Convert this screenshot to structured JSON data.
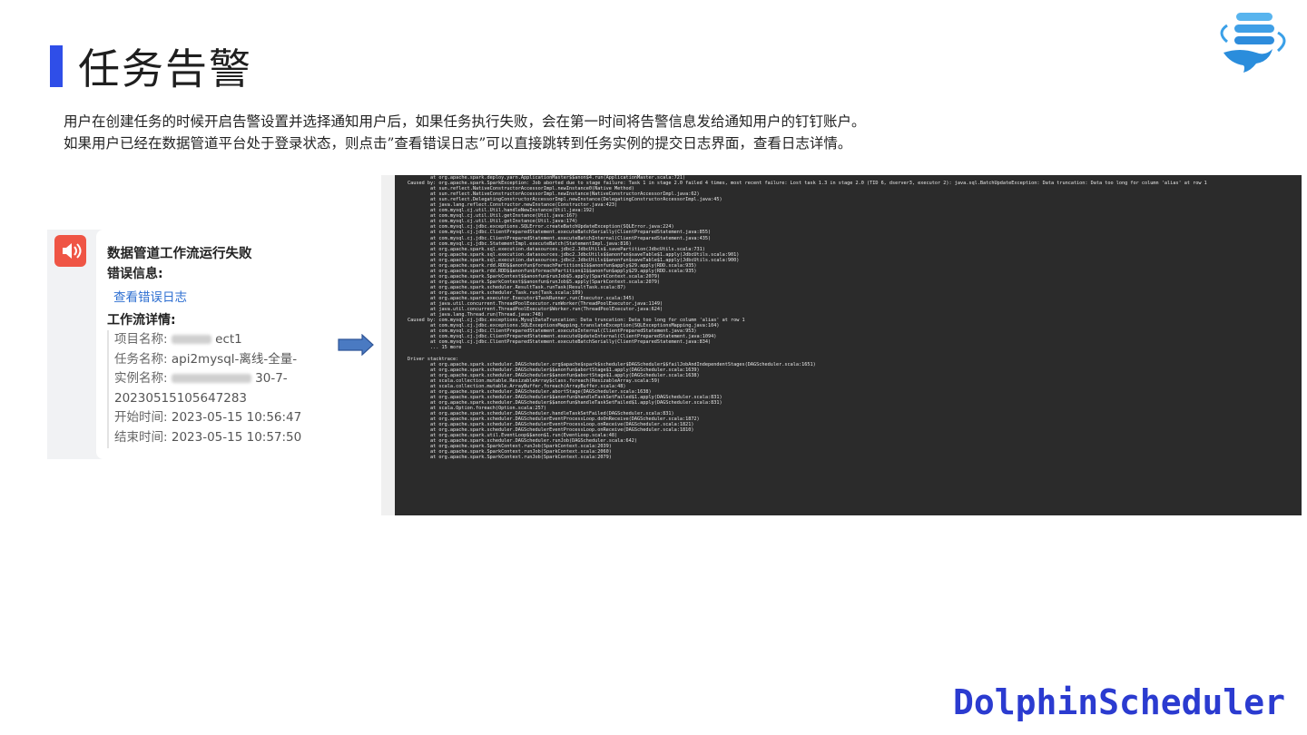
{
  "page": {
    "title": "任务告警",
    "description_line1": "用户在创建任务的时候开启告警设置并选择通知用户后，如果任务执行失败，会在第一时间将告警信息发给通知用户的钉钉账户。",
    "description_line2": "如果用户已经在数据管道平台处于登录状态，则点击”查看错误日志”可以直接跳转到任务实例的提交日志界面，查看日志详情。",
    "brand": "DolphinScheduler",
    "accent_color": "#2f4ee8"
  },
  "alert_card": {
    "icon": "speaker-alert-icon",
    "title": "数据管道工作流运行失败",
    "error_label": "错误信息:",
    "error_link": "查看错误日志",
    "detail_label": "工作流详情:",
    "project_label": "项目名称:",
    "project_value": "ect1",
    "task_label": "任务名称:",
    "task_value": "api2mysql-离线-全量-",
    "instance_label": "实例名称:",
    "instance_value_suffix": "30-7-",
    "instance_value_line2": "20230515105647283",
    "start_label": "开始时间:",
    "start_value": "2023-05-15 10:56:47",
    "end_label": "结束时间:",
    "end_value": "2023-05-15 10:57:50"
  },
  "log": {
    "lines": [
      "        at org.apache.spark.deploy.yarn.ApplicationMaster$$anon$4.run(ApplicationMaster.scala:721)",
      "Caused by: org.apache.spark.SparkException: Job aborted due to stage failure: Task 1 in stage 2.0 failed 4 times, most recent failure: Lost task 1.3 in stage 2.0 (TID 6, dserver3, executor 2): java.sql.BatchUpdateException: Data truncation: Data too long for column 'alias' at row 1",
      "        at sun.reflect.NativeConstructorAccessorImpl.newInstance0(Native Method)",
      "        at sun.reflect.NativeConstructorAccessorImpl.newInstance(NativeConstructorAccessorImpl.java:62)",
      "        at sun.reflect.DelegatingConstructorAccessorImpl.newInstance(DelegatingConstructorAccessorImpl.java:45)",
      "        at java.lang.reflect.Constructor.newInstance(Constructor.java:423)",
      "        at com.mysql.cj.util.Util.handleNewInstance(Util.java:192)",
      "        at com.mysql.cj.util.Util.getInstance(Util.java:167)",
      "        at com.mysql.cj.util.Util.getInstance(Util.java:174)",
      "        at com.mysql.cj.jdbc.exceptions.SQLError.createBatchUpdateException(SQLError.java:224)",
      "        at com.mysql.cj.jdbc.ClientPreparedStatement.executeBatchSerially(ClientPreparedStatement.java:855)",
      "        at com.mysql.cj.jdbc.ClientPreparedStatement.executeBatchInternal(ClientPreparedStatement.java:435)",
      "        at com.mysql.cj.jdbc.StatementImpl.executeBatch(StatementImpl.java:816)",
      "        at org.apache.spark.sql.execution.datasources.jdbc2.JdbcUtils$.savePartition(JdbcUtils.scala:731)",
      "        at org.apache.spark.sql.execution.datasources.jdbc2.JdbcUtils$$anonfun$saveTable$1.apply(JdbcUtils.scala:901)",
      "        at org.apache.spark.sql.execution.datasources.jdbc2.JdbcUtils$$anonfun$saveTable$1.apply(JdbcUtils.scala:900)",
      "        at org.apache.spark.rdd.RDD$$anonfun$foreachPartition$1$$anonfun$apply$29.apply(RDD.scala:935)",
      "        at org.apache.spark.rdd.RDD$$anonfun$foreachPartition$1$$anonfun$apply$29.apply(RDD.scala:935)",
      "        at org.apache.spark.SparkContext$$anonfun$runJob$5.apply(SparkContext.scala:2079)",
      "        at org.apache.spark.SparkContext$$anonfun$runJob$5.apply(SparkContext.scala:2079)",
      "        at org.apache.spark.scheduler.ResultTask.runTask(ResultTask.scala:87)",
      "        at org.apache.spark.scheduler.Task.run(Task.scala:109)",
      "        at org.apache.spark.executor.Executor$TaskRunner.run(Executor.scala:345)",
      "        at java.util.concurrent.ThreadPoolExecutor.runWorker(ThreadPoolExecutor.java:1149)",
      "        at java.util.concurrent.ThreadPoolExecutor$Worker.run(ThreadPoolExecutor.java:624)",
      "        at java.lang.Thread.run(Thread.java:748)",
      "Caused by: com.mysql.cj.jdbc.exceptions.MysqlDataTruncation: Data truncation: Data too long for column 'alias' at row 1",
      "        at com.mysql.cj.jdbc.exceptions.SQLExceptionsMapping.translateException(SQLExceptionsMapping.java:104)",
      "        at com.mysql.cj.jdbc.ClientPreparedStatement.executeInternal(ClientPreparedStatement.java:953)",
      "        at com.mysql.cj.jdbc.ClientPreparedStatement.executeUpdateInternal(ClientPreparedStatement.java:1094)",
      "        at com.mysql.cj.jdbc.ClientPreparedStatement.executeBatchSerially(ClientPreparedStatement.java:834)",
      "        ... 15 more",
      "",
      "Driver stacktrace:",
      "        at org.apache.spark.scheduler.DAGScheduler.org$apache$spark$scheduler$DAGScheduler$$failJobAndIndependentStages(DAGScheduler.scala:1651)",
      "        at org.apache.spark.scheduler.DAGScheduler$$anonfun$abortStage$1.apply(DAGScheduler.scala:1639)",
      "        at org.apache.spark.scheduler.DAGScheduler$$anonfun$abortStage$1.apply(DAGScheduler.scala:1638)",
      "        at scala.collection.mutable.ResizableArray$class.foreach(ResizableArray.scala:59)",
      "        at scala.collection.mutable.ArrayBuffer.foreach(ArrayBuffer.scala:48)",
      "        at org.apache.spark.scheduler.DAGScheduler.abortStage(DAGScheduler.scala:1638)",
      "        at org.apache.spark.scheduler.DAGScheduler$$anonfun$handleTaskSetFailed$1.apply(DAGScheduler.scala:831)",
      "        at org.apache.spark.scheduler.DAGScheduler$$anonfun$handleTaskSetFailed$1.apply(DAGScheduler.scala:831)",
      "        at scala.Option.foreach(Option.scala:257)",
      "        at org.apache.spark.scheduler.DAGScheduler.handleTaskSetFailed(DAGScheduler.scala:831)",
      "        at org.apache.spark.scheduler.DAGSchedulerEventProcessLoop.doOnReceive(DAGScheduler.scala:1872)",
      "        at org.apache.spark.scheduler.DAGSchedulerEventProcessLoop.onReceive(DAGScheduler.scala:1821)",
      "        at org.apache.spark.scheduler.DAGSchedulerEventProcessLoop.onReceive(DAGScheduler.scala:1810)",
      "        at org.apache.spark.util.EventLoop$$anon$1.run(EventLoop.scala:48)",
      "        at org.apache.spark.scheduler.DAGScheduler.runJob(DAGScheduler.scala:642)",
      "        at org.apache.spark.SparkContext.runJob(SparkContext.scala:2039)",
      "        at org.apache.spark.SparkContext.runJob(SparkContext.scala:2060)",
      "        at org.apache.spark.SparkContext.runJob(SparkContext.scala:2079)"
    ]
  }
}
